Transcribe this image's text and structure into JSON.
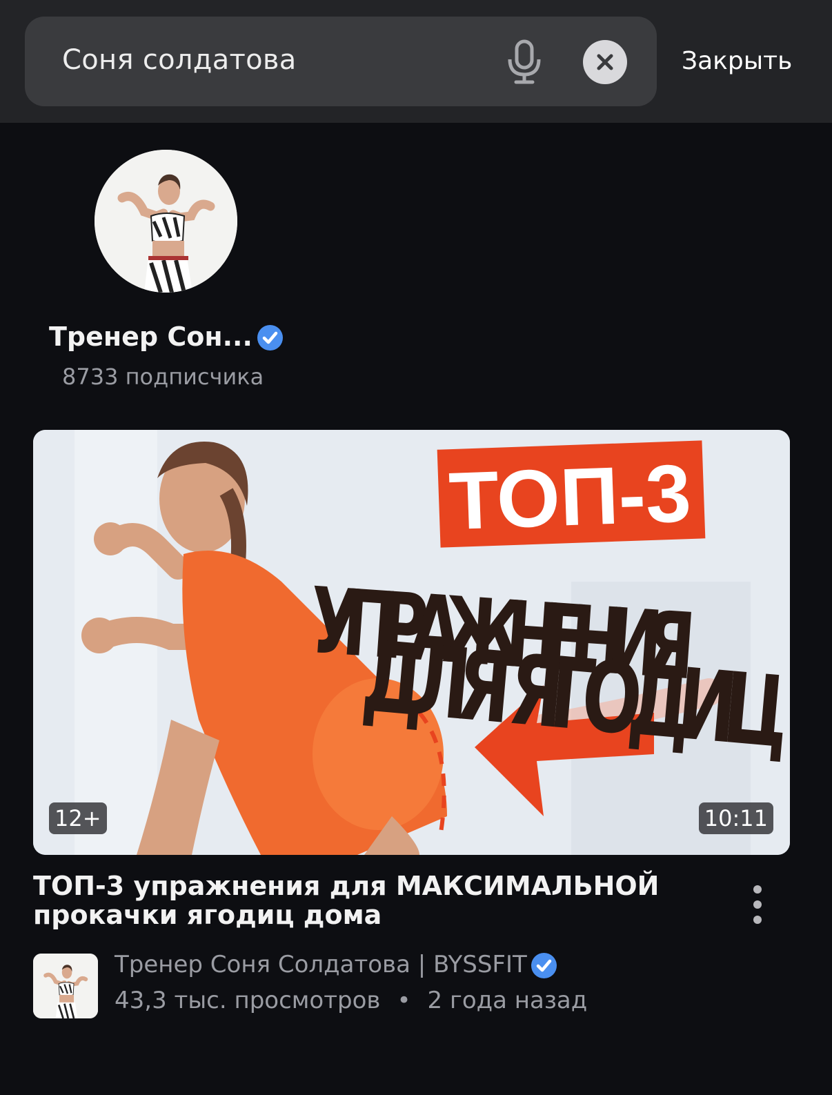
{
  "search": {
    "query": "Соня солдатова",
    "close_label": "Закрыть"
  },
  "channel": {
    "name": "Тренер Сон...",
    "subscribers": "8733 подписчика"
  },
  "video": {
    "thumbnail": {
      "headline_top": "ТОП-3",
      "headline_line1": "УПРАЖНЕНИЯ",
      "headline_line2": "ДЛЯ ЯГОДИЦ",
      "age_rating": "12+",
      "duration": "10:11"
    },
    "title": "ТОП-3 упражнения для МАКСИМАЛЬНОЙ прокачки ягодиц дома",
    "channel_name": "Тренер Соня Солдатова | BYSSFIT",
    "views": "43,3 тыс. просмотров",
    "separator": "•",
    "age": "2 года назад"
  },
  "colors": {
    "background": "#0d0e12",
    "topbar": "#232427",
    "search_field": "#3a3b3e",
    "verified": "#4a8ff0",
    "thumbnail_accent": "#e8441f"
  },
  "icons": [
    "mic-icon",
    "clear-icon",
    "verified-icon",
    "more-icon"
  ]
}
